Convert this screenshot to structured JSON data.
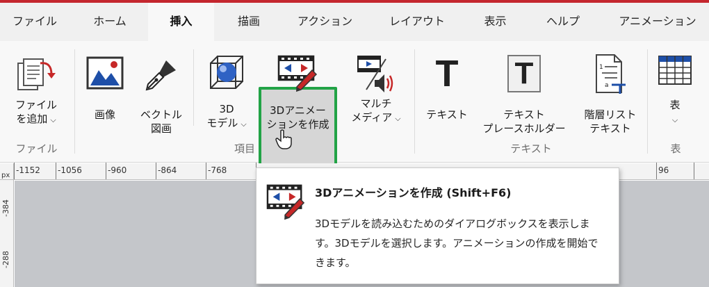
{
  "tabs": [
    "ファイル",
    "ホーム",
    "挿入",
    "描画",
    "アクション",
    "レイアウト",
    "表示",
    "ヘルプ",
    "アニメーション"
  ],
  "active_tab": "挿入",
  "ribbon": {
    "add_file": "ファイル\nを追加",
    "image": "画像",
    "vector": "ベクトル\n図画",
    "model3d": "3D\nモデル",
    "create_3d_anim": "3Dアニメー\nションを作成",
    "multimedia": "マルチ\nメディア",
    "text": "テキスト",
    "text_placeholder": "テキスト\nプレースホルダー",
    "list_text": "階層リスト\nテキスト",
    "table": "表",
    "groups": {
      "file": "ファイル",
      "items": "項目",
      "text": "テキスト",
      "table": "表"
    }
  },
  "ruler": {
    "h_labels": [
      "-1152",
      "-1056",
      "-960",
      "-864",
      "-768",
      "96"
    ],
    "unit": "px",
    "v_labels": [
      "-384",
      "-288"
    ]
  },
  "tooltip": {
    "title": "3Dアニメーションを作成 (Shift+F6)",
    "description": "3Dモデルを読み込むためのダイアログボックスを表示します。3Dモデルを選択します。アニメーションの作成を開始できます。"
  },
  "colors": {
    "accent_bar": "#c4262e",
    "selection": "#22a346",
    "icon_red": "#c62828",
    "icon_blue": "#1e4fa8"
  }
}
